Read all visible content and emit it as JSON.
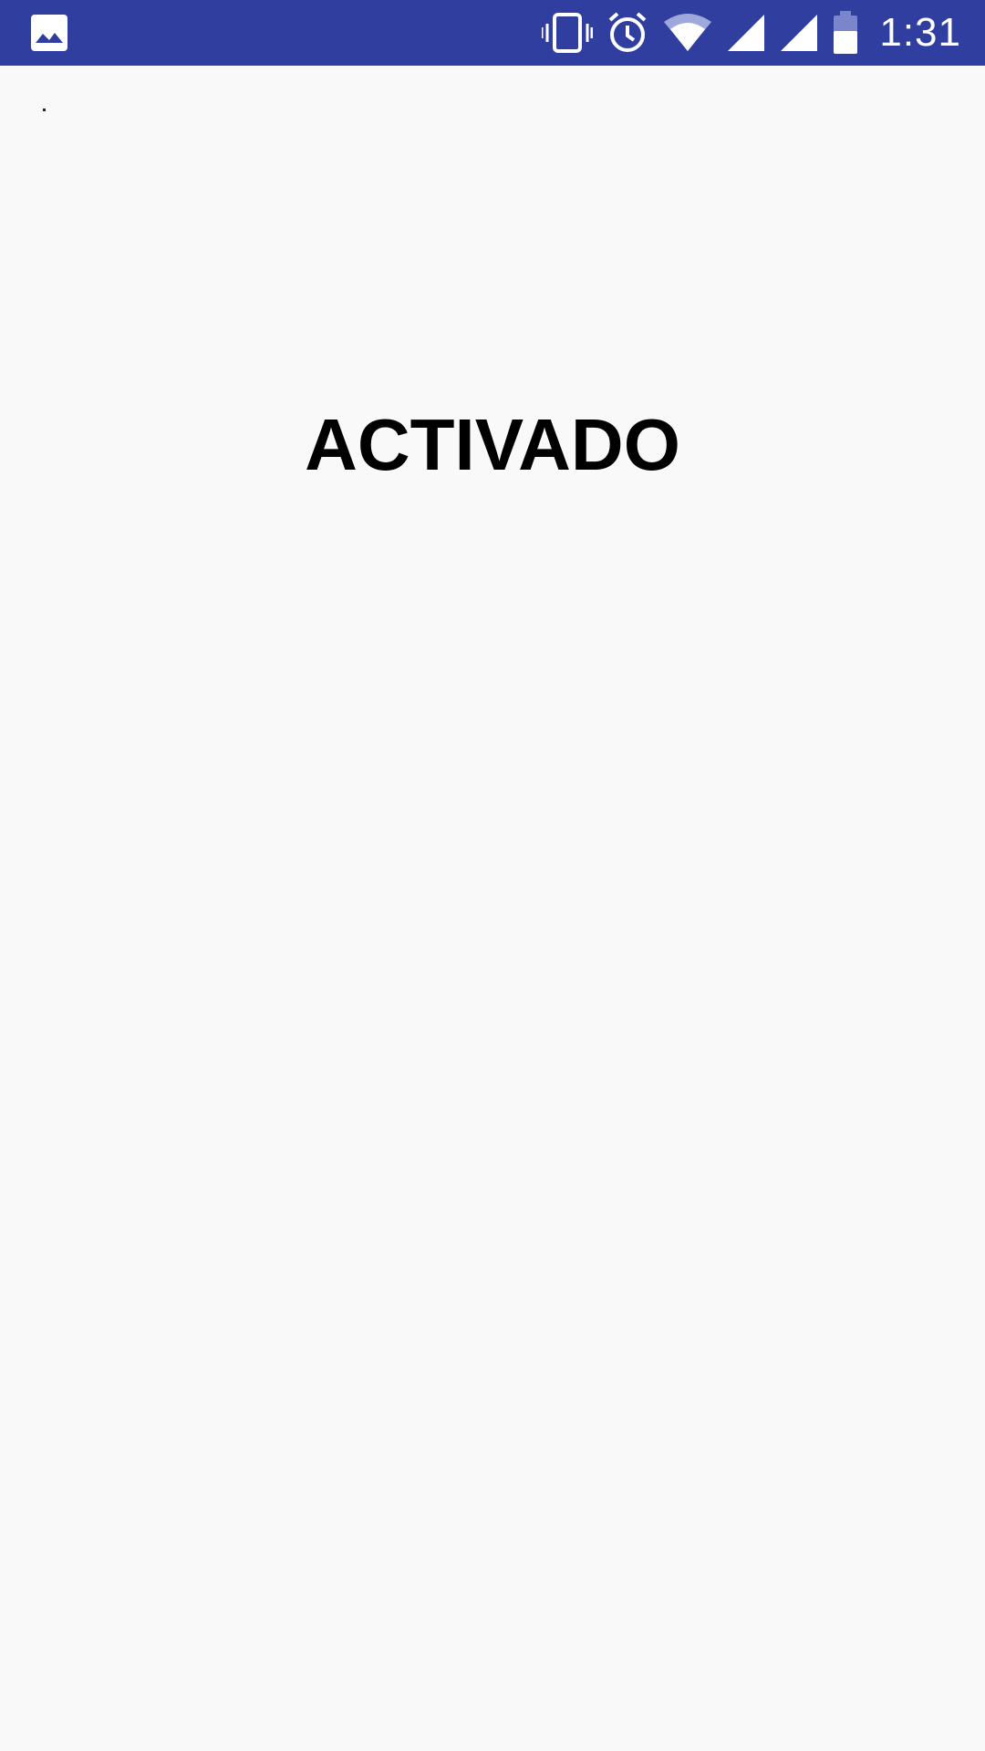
{
  "status_bar": {
    "background_color": "#303f9f",
    "time": "1:31",
    "icons": [
      "image-notification-icon",
      "vibrate-icon",
      "alarm-icon",
      "wifi-icon",
      "signal-icon",
      "signal-icon",
      "battery-icon"
    ]
  },
  "main": {
    "title": "ACTIVADO",
    "background_color": "#f9f9f9"
  }
}
